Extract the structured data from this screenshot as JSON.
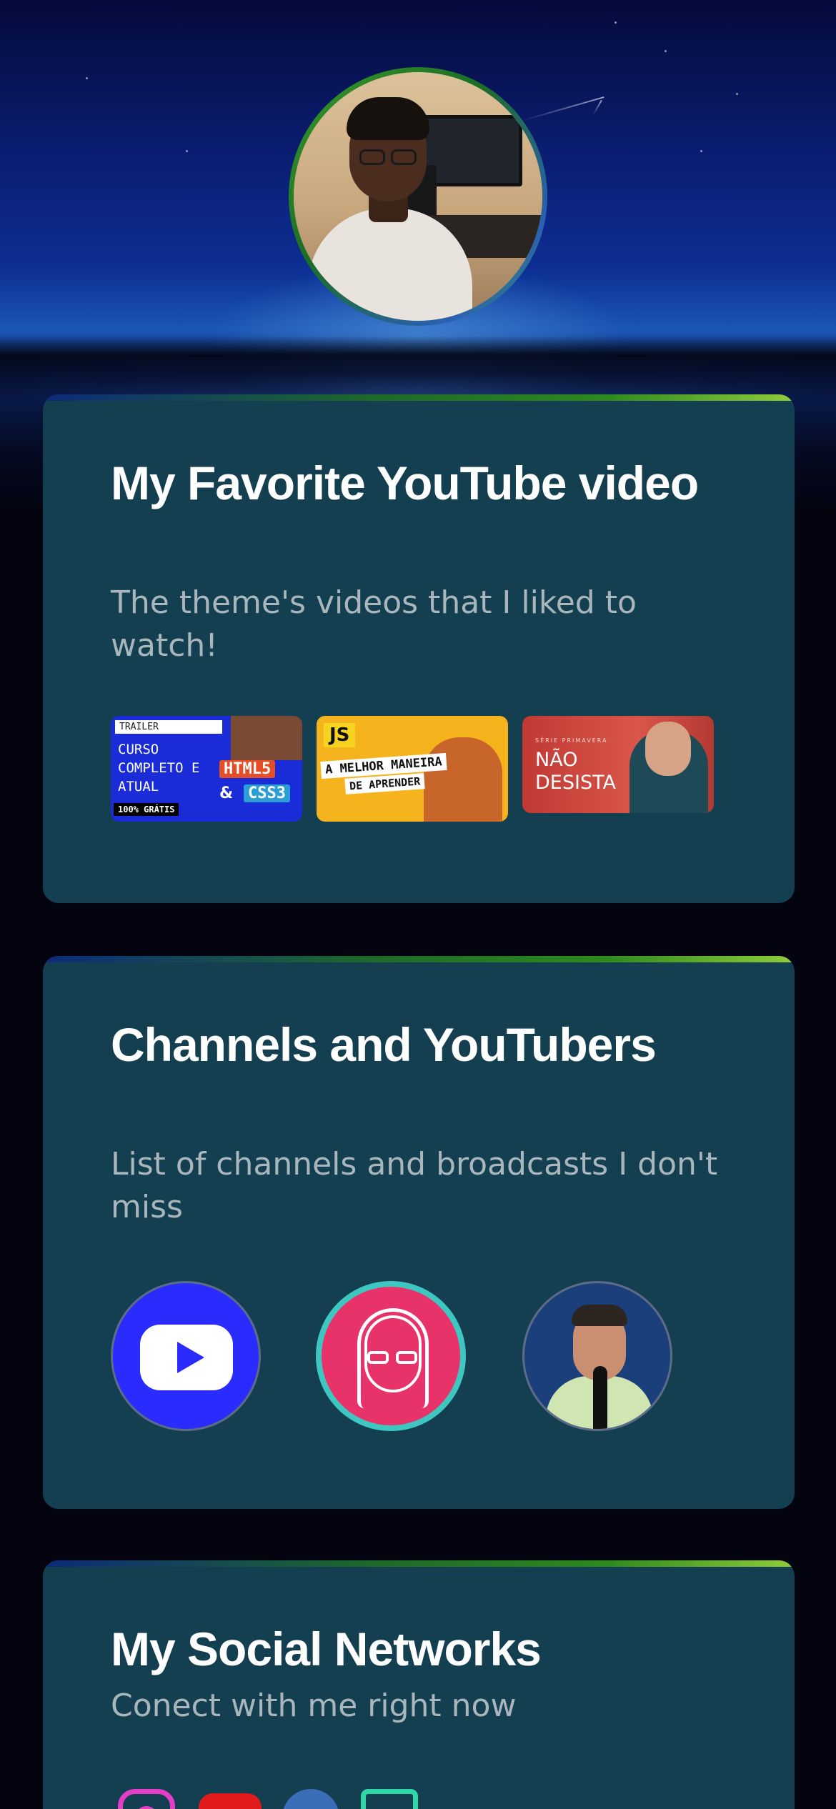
{
  "profile": {
    "avatar_icon": "profile-photo"
  },
  "favorite_videos": {
    "title": "My Favorite YouTube video",
    "subtitle": "The theme's videos that I liked to watch!",
    "thumbnails": [
      {
        "tag": "TRAILER",
        "lines": "CURSO COMPLETO E ATUAL",
        "badge": "100% GRÁTIS",
        "html_label": "HTML5",
        "amp": "&",
        "css_label": "CSS3",
        "accent": "#1a2bd8"
      },
      {
        "badge": "JS",
        "line1": "A MELHOR MANEIRA",
        "line2": "DE APRENDER",
        "accent": "#f5b41e"
      },
      {
        "kicker": "SÉRIE PRIMAVERA",
        "title": "NÃO DESISTA",
        "accent": "#c03a33"
      }
    ]
  },
  "channels": {
    "title": "Channels and YouTubers",
    "subtitle": "List of channels and broadcasts I don't miss",
    "items": [
      {
        "icon": "play-logo",
        "color": "#2a2bff"
      },
      {
        "icon": "illustrated-woman-avatar",
        "color": "#e8336a"
      },
      {
        "icon": "man-with-microphone-avatar",
        "color": "#1a3f7a"
      }
    ]
  },
  "socials": {
    "title": "My Social Networks",
    "subtitle": "Conect with me right now",
    "items": [
      {
        "icon": "instagram-icon",
        "color": "#e43ec7"
      },
      {
        "icon": "youtube-icon",
        "color": "#e11b1b"
      },
      {
        "icon": "github-icon",
        "color": "#3a6fb8"
      },
      {
        "icon": "portfolio-icon",
        "color": "#2fd6a8"
      }
    ]
  }
}
